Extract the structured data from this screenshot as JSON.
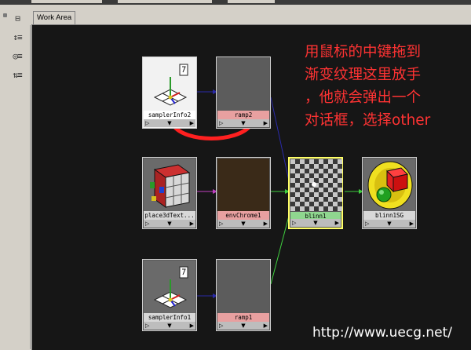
{
  "tabs": [
    {
      "label": "Work Area"
    }
  ],
  "toolbar": {
    "tools": [
      {
        "icon": "layout-up-icon",
        "glyph": "⊟"
      },
      {
        "icon": "sort-icon",
        "glyph": "↕≡"
      },
      {
        "icon": "refresh-icon",
        "glyph": "◎≡"
      },
      {
        "icon": "swap-icon",
        "glyph": "⇅≡"
      }
    ]
  },
  "nodes": {
    "samplerInfo2": {
      "label": "samplerInfo2"
    },
    "ramp2": {
      "label": "ramp2"
    },
    "place3dTexture": {
      "label": "place3dText..."
    },
    "envChrome1": {
      "label": "envChrome1"
    },
    "blinn1": {
      "label": "blinn1"
    },
    "blinn1SG": {
      "label": "blinn1SG"
    },
    "samplerInfo1": {
      "label": "samplerInfo1"
    },
    "ramp1": {
      "label": "ramp1"
    }
  },
  "node_footer": {
    "left": "▷",
    "center": "▼",
    "right": "▶"
  },
  "annotation": {
    "lines": [
      "用鼠标的中键拖到",
      "渐变纹理这里放手",
      "，他就会弹出一个",
      "对话框，选择other"
    ],
    "color": "#ff3333"
  },
  "watermark": "http://www.uecg.net/",
  "colors": {
    "canvas": "#161616",
    "wire_blue": "#2a2aa8",
    "wire_green": "#3fcf3f",
    "wire_purple": "#c040c0",
    "selection": "#ffff66"
  }
}
